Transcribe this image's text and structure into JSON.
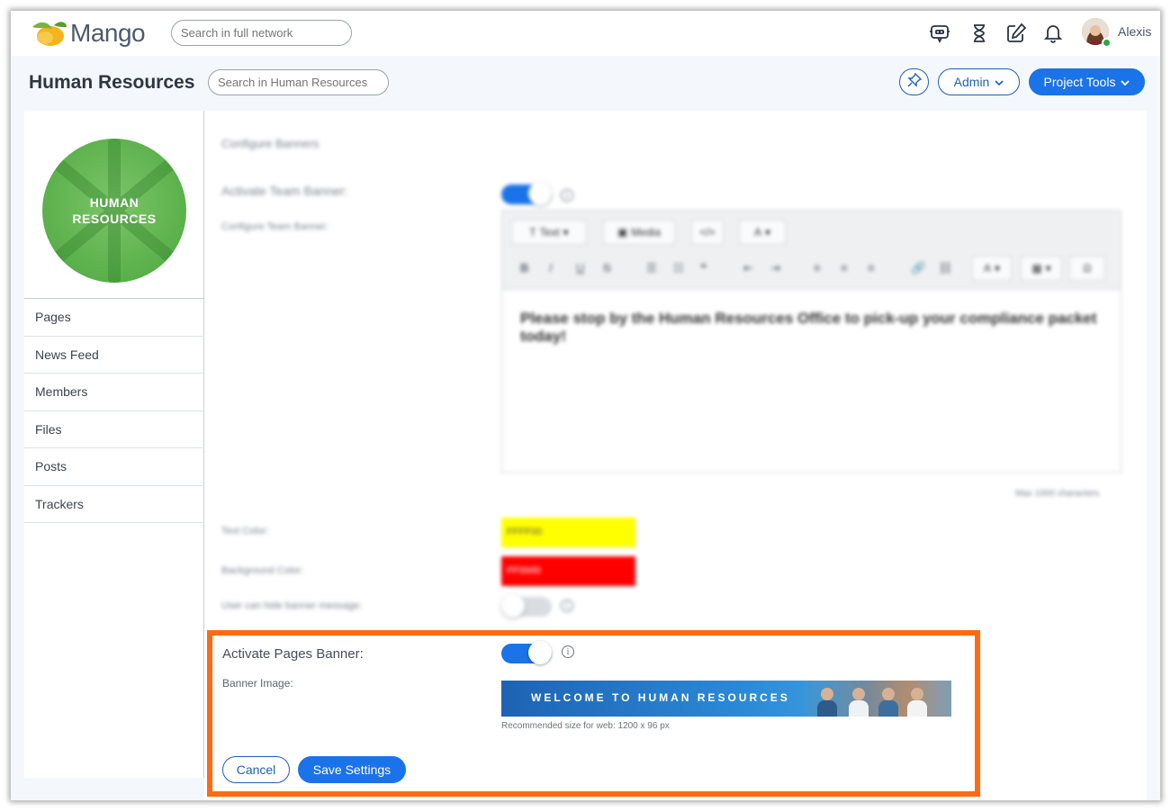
{
  "app": {
    "logo_text": "Mango",
    "network_search_placeholder": "Search in full network",
    "user_name": "Alexis"
  },
  "header": {
    "title": "Human Resources",
    "search_placeholder": "Search in Human Resources",
    "admin_label": "Admin",
    "project_tools_label": "Project Tools"
  },
  "sidebar": {
    "team_image_text": "HUMAN RESOURCES",
    "items": [
      {
        "label": "Pages"
      },
      {
        "label": "News Feed"
      },
      {
        "label": "Members"
      },
      {
        "label": "Files"
      },
      {
        "label": "Posts"
      },
      {
        "label": "Trackers"
      }
    ]
  },
  "config": {
    "section_title": "Configure Banners",
    "activate_team_banner_label": "Activate Team Banner:",
    "activate_team_banner_on": true,
    "configure_team_banner_label": "Configure Team Banner:",
    "editor": {
      "text_dropdown": "Text",
      "media_button": "Media",
      "content": "Please stop by the Human Resources Office to pick-up your compliance packet today!",
      "max_chars": "Max 1000 characters"
    },
    "text_color_label": "Text Color:",
    "text_color_value": "FFFF00",
    "text_color_hex": "#ffff00",
    "background_color_label": "Background Color:",
    "background_color_value": "FF0000",
    "background_color_hex": "#ff0000",
    "user_hide_label": "User can hide banner message:",
    "user_hide_on": false,
    "activate_pages_banner_label": "Activate Pages Banner:",
    "activate_pages_banner_on": true,
    "banner_image_label": "Banner Image:",
    "banner_image_text": "WELCOME TO HUMAN RESOURCES",
    "recommended_size": "Recommended size for web: 1200 x 96 px"
  },
  "actions": {
    "cancel_label": "Cancel",
    "save_label": "Save Settings"
  },
  "colors": {
    "accent": "#1a73e8",
    "highlight_border": "#ff6a13"
  }
}
